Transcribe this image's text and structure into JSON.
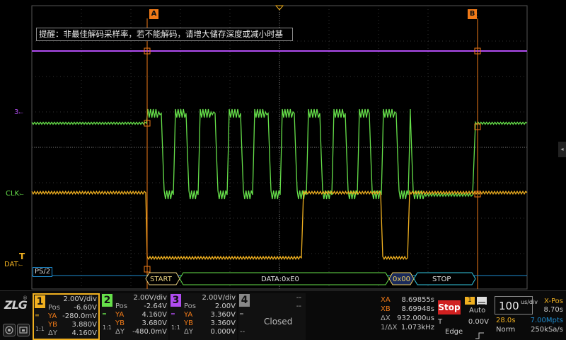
{
  "hint": "提醒：非最佳解码采样率，若不能解码，请增大储存深度或减小时基",
  "cursors": {
    "a_label": "A",
    "b_label": "B"
  },
  "channel_markers": {
    "ch3": "3",
    "clk": "CLK",
    "dat": "DAT",
    "trig": "T"
  },
  "decode": {
    "bus_label": "PS/2",
    "start": "START",
    "data": "DATA:0xE0",
    "byte": "0x00",
    "stop": "STOP"
  },
  "colors": {
    "ch1": "#f0b020",
    "ch2": "#66e04a",
    "ch3": "#b04cf0",
    "ch4": "#888888",
    "cursor": "#f07a18",
    "bus": "#1e8cd0"
  },
  "logo": "ZLG",
  "ch1": {
    "num": "1",
    "div": "2.00V/div",
    "pos_label": "Pos",
    "pos": "-6.60V",
    "ya_label": "YA",
    "ya": "-280.0mV",
    "yb_label": "YB",
    "yb": "3.880V",
    "dy_label": "ΔY",
    "dy": "4.160V",
    "ratio": "1:1"
  },
  "ch2": {
    "num": "2",
    "div": "2.00V/div",
    "pos_label": "Pos",
    "pos": "-2.64V",
    "ya_label": "YA",
    "ya": "4.160V",
    "yb_label": "YB",
    "yb": "3.680V",
    "dy_label": "ΔY",
    "dy": "-480.0mV",
    "ratio": "1:1"
  },
  "ch3": {
    "num": "3",
    "div": "2.00V/div",
    "pos_label": "Pos",
    "pos": "2.00V",
    "ya_label": "YA",
    "ya": "3.360V",
    "yb_label": "YB",
    "yb": "3.360V",
    "dy_label": "ΔY",
    "dy": "0.000V",
    "ratio": "1:1"
  },
  "ch4": {
    "num": "4",
    "dash1": "--",
    "dash2": "--",
    "state": "Closed",
    "dash3": "--"
  },
  "measure": {
    "xa_label": "XA",
    "xa": "8.69855s",
    "xb_label": "XB",
    "xb": "8.69948s",
    "dx_label": "ΔX",
    "dx": "932.000us",
    "inv_label": "1/ΔX",
    "inv": "1.073kHz"
  },
  "run": {
    "state": "Stop",
    "trig_src": "1",
    "mode": "Auto",
    "t_label": "T",
    "level": "0.00V",
    "type": "Edge"
  },
  "timebase": {
    "value": "100",
    "unit": "us/div",
    "xpos_label": "X-Pos",
    "xpos": "8.70s",
    "time": "28.0s",
    "mpts": "7.00Mpts",
    "acq": "Norm",
    "rate": "250kSa/s"
  }
}
